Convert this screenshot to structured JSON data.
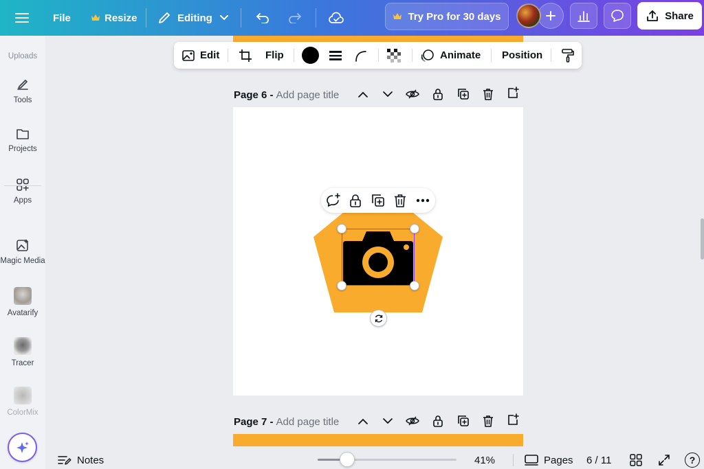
{
  "topbar": {
    "file": "File",
    "resize": "Resize",
    "editing": "Editing",
    "pro": "Try Pro for 30 days",
    "share": "Share"
  },
  "sidebar": {
    "items": [
      {
        "label": "Uploads"
      },
      {
        "label": "Tools"
      },
      {
        "label": "Projects"
      },
      {
        "label": "Apps"
      },
      {
        "label": "Magic Media"
      },
      {
        "label": "Avatarify"
      },
      {
        "label": "Tracer"
      },
      {
        "label": "ColorMix"
      }
    ]
  },
  "context_toolbar": {
    "edit": "Edit",
    "flip": "Flip",
    "animate": "Animate",
    "position": "Position",
    "color": "#000000"
  },
  "pages": [
    {
      "label": "Page 6 -",
      "title_placeholder": "Add page title"
    },
    {
      "label": "Page 7 -",
      "title_placeholder": "Add page title"
    }
  ],
  "design": {
    "hexagon_color": "#f9ab2d",
    "camera_color": "#000000",
    "selection_color": "#8b3dff"
  },
  "bottombar": {
    "notes": "Notes",
    "zoom": "41%",
    "zoom_value": 0.41,
    "pages": "Pages",
    "page_count": "6 / 11",
    "help": "?"
  }
}
